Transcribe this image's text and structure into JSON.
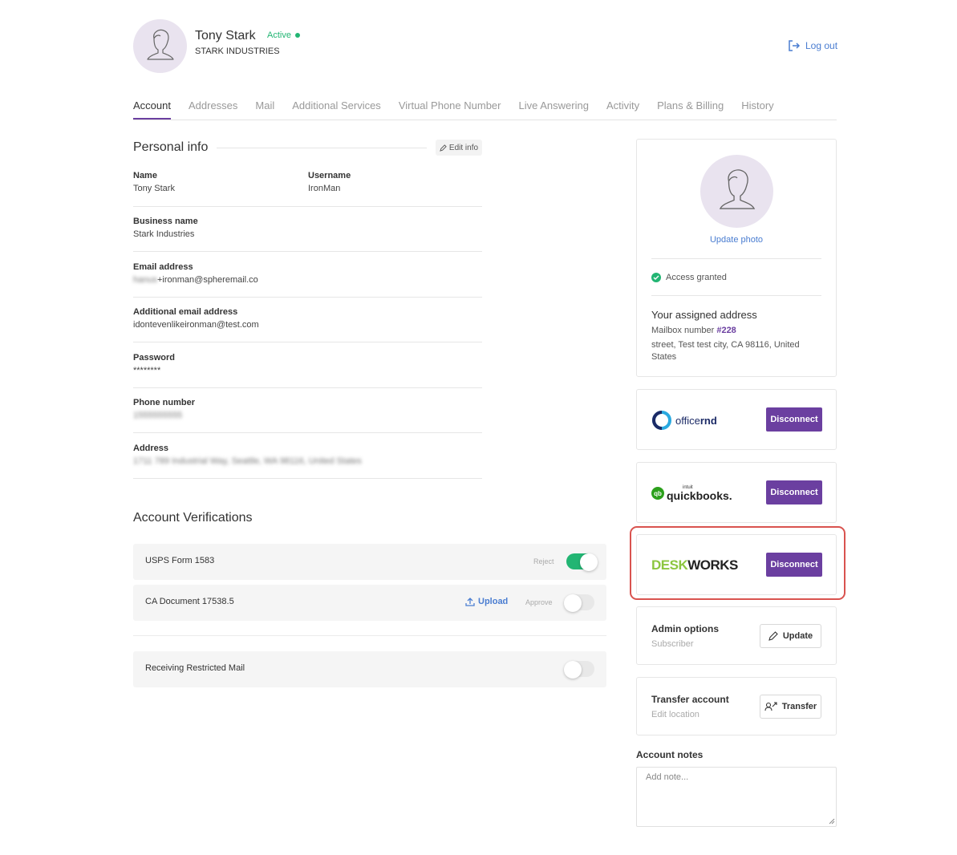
{
  "user": {
    "name": "Tony Stark",
    "status": "Active",
    "company": "STARK INDUSTRIES"
  },
  "header": {
    "logout_label": "Log out"
  },
  "tabs": [
    {
      "label": "Account",
      "active": true
    },
    {
      "label": "Addresses"
    },
    {
      "label": "Mail"
    },
    {
      "label": "Additional Services"
    },
    {
      "label": "Virtual Phone Number"
    },
    {
      "label": "Live Answering"
    },
    {
      "label": "Activity"
    },
    {
      "label": "Plans & Billing"
    },
    {
      "label": "History"
    }
  ],
  "personal_info": {
    "title": "Personal info",
    "edit_label": "Edit info",
    "name_label": "Name",
    "name_value": "Tony Stark",
    "username_label": "Username",
    "username_value": "IronMan",
    "business_label": "Business name",
    "business_value": "Stark Industries",
    "email_label": "Email address",
    "email_value_hidden": "hanus",
    "email_value": "+ironman@spheremail.co",
    "additional_email_label": "Additional email address",
    "additional_email_value": "idontevenlikeironman@test.com",
    "password_label": "Password",
    "password_value": "********",
    "phone_label": "Phone number",
    "phone_value": "1555555555",
    "address_label": "Address",
    "address_value": "1711 789 Industrial Way, Seattle, WA 98116, United States"
  },
  "verifications": {
    "title": "Account Verifications",
    "rows": [
      {
        "label": "USPS Form 1583",
        "action": "Reject",
        "enabled": true
      },
      {
        "label": "CA Document 17538.5",
        "upload_label": "Upload",
        "action": "Approve",
        "enabled": false
      }
    ],
    "restricted_mail_label": "Receiving Restricted Mail",
    "restricted_mail_enabled": false
  },
  "profile_card": {
    "update_photo_label": "Update photo",
    "access_label": "Access granted",
    "assigned_title": "Your assigned address",
    "mailbox_label": "Mailbox number",
    "mailbox_number": "#228",
    "street": "street, Test test city, CA 98116, United States"
  },
  "integrations": [
    {
      "name": "officernd",
      "logo_text_a": "office",
      "logo_text_b": "rnd",
      "button_label": "Disconnect"
    },
    {
      "name": "quickbooks",
      "logo_small": "intuit",
      "logo_text": "quickbooks.",
      "button_label": "Disconnect"
    },
    {
      "name": "deskworks",
      "logo_text_a": "DESK",
      "logo_text_b": "WORKS",
      "button_label": "Disconnect"
    }
  ],
  "admin_options": {
    "title": "Admin options",
    "subtitle": "Subscriber",
    "button_label": "Update"
  },
  "transfer": {
    "title": "Transfer account",
    "subtitle": "Edit location",
    "button_label": "Transfer"
  },
  "notes": {
    "label": "Account notes",
    "placeholder": "Add note..."
  },
  "colors": {
    "brand_purple": "#6b3fa0",
    "active_green": "#22b573",
    "link_blue": "#4a7dd1",
    "highlight_red": "#d9534f"
  }
}
